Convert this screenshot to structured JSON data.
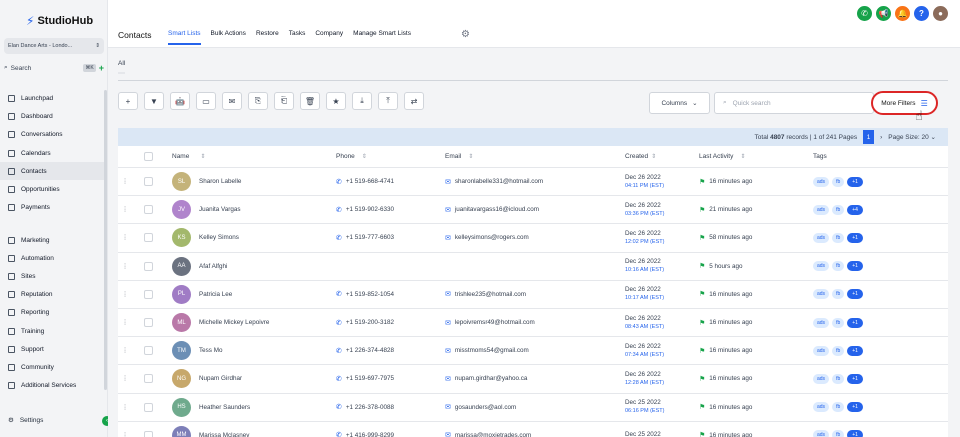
{
  "app": {
    "name": "StudioHub",
    "account": "Elan Dance Arts - Londo..."
  },
  "sidebar": {
    "search_label": "Search",
    "search_shortcut": "⌘K",
    "items": [
      {
        "label": "Launchpad",
        "icon": "rocket-icon"
      },
      {
        "label": "Dashboard",
        "icon": "dashboard-icon"
      },
      {
        "label": "Conversations",
        "icon": "chat-icon"
      },
      {
        "label": "Calendars",
        "icon": "calendar-icon"
      },
      {
        "label": "Contacts",
        "icon": "contacts-icon",
        "active": true
      },
      {
        "label": "Opportunities",
        "icon": "opportunities-icon"
      },
      {
        "label": "Payments",
        "icon": "payments-icon"
      }
    ],
    "items2": [
      {
        "label": "Marketing",
        "icon": "marketing-icon"
      },
      {
        "label": "Automation",
        "icon": "automation-icon"
      },
      {
        "label": "Sites",
        "icon": "sites-icon"
      },
      {
        "label": "Reputation",
        "icon": "reputation-icon"
      },
      {
        "label": "Reporting",
        "icon": "reporting-icon"
      },
      {
        "label": "Training",
        "icon": "training-icon"
      },
      {
        "label": "Support",
        "icon": "support-icon"
      },
      {
        "label": "Community",
        "icon": "community-icon"
      },
      {
        "label": "Additional Services",
        "icon": "services-icon"
      }
    ],
    "settings": "Settings"
  },
  "header": {
    "title": "Contacts",
    "tabs": [
      "Smart Lists",
      "Bulk Actions",
      "Restore",
      "Tasks",
      "Company",
      "Manage Smart Lists"
    ]
  },
  "content": {
    "all_tab": "All",
    "columns_label": "Columns",
    "search_placeholder": "Quick search",
    "more_filters_label": "More Filters",
    "total_text_prefix": "Total",
    "total_records": "4807",
    "total_text_suffix": "records | 1 of 241 Pages",
    "current_page": "1",
    "page_size_label": "Page Size: 20"
  },
  "table": {
    "headers": {
      "name": "Name",
      "phone": "Phone",
      "email": "Email",
      "created": "Created",
      "activity": "Last Activity",
      "tags": "Tags"
    },
    "rows": [
      {
        "initials": "SL",
        "color": "#c4b37a",
        "name": "Sharon Labelle",
        "phone": "+1 519-668-4741",
        "email": "sharonlabelle331@hotmail.com",
        "date": "Dec 26 2022",
        "time": "04:11 PM (EST)",
        "activity": "16 minutes ago",
        "more": "+1"
      },
      {
        "initials": "JV",
        "color": "#b084cc",
        "name": "Juanita Vargas",
        "phone": "+1 519-902-6330",
        "email": "juanitavargass16@icloud.com",
        "date": "Dec 26 2022",
        "time": "03:36 PM (EST)",
        "activity": "21 minutes ago",
        "more": "+4"
      },
      {
        "initials": "KS",
        "color": "#a3b86c",
        "name": "Kelley Simons",
        "phone": "+1 519-777-6603",
        "email": "kelleysimons@rogers.com",
        "date": "Dec 26 2022",
        "time": "12:02 PM (EST)",
        "activity": "58 minutes ago",
        "more": "+1"
      },
      {
        "initials": "AA",
        "color": "#6b7280",
        "name": "Afaf Alfghi",
        "phone": "",
        "email": "",
        "date": "Dec 26 2022",
        "time": "10:16 AM (EST)",
        "activity": "5 hours ago",
        "more": "+1"
      },
      {
        "initials": "PL",
        "color": "#a07cc5",
        "name": "Patricia Lee",
        "phone": "+1 519-852-1054",
        "email": "trishlee235@hotmail.com",
        "date": "Dec 26 2022",
        "time": "10:17 AM (EST)",
        "activity": "16 minutes ago",
        "more": "+1"
      },
      {
        "initials": "ML",
        "color": "#b978a8",
        "name": "Michelle Mickey Lepoivre",
        "phone": "+1 519-200-3182",
        "email": "lepoivremsr49@hotmail.com",
        "date": "Dec 26 2022",
        "time": "08:43 AM (EST)",
        "activity": "16 minutes ago",
        "more": "+1"
      },
      {
        "initials": "TM",
        "color": "#6c8fb5",
        "name": "Tess Mo",
        "phone": "+1 226-374-4828",
        "email": "misstmoms54@gmail.com",
        "date": "Dec 26 2022",
        "time": "07:34 AM (EST)",
        "activity": "16 minutes ago",
        "more": "+1"
      },
      {
        "initials": "NG",
        "color": "#c7a86b",
        "name": "Nupam Girdhar",
        "phone": "+1 519-697-7975",
        "email": "nupam.girdhar@yahoo.ca",
        "date": "Dec 26 2022",
        "time": "12:28 AM (EST)",
        "activity": "16 minutes ago",
        "more": "+1"
      },
      {
        "initials": "HS",
        "color": "#6faa8d",
        "name": "Heather Saunders",
        "phone": "+1 226-378-0088",
        "email": "gosaunders@aol.com",
        "date": "Dec 25 2022",
        "time": "06:16 PM (EST)",
        "activity": "16 minutes ago",
        "more": "+1"
      },
      {
        "initials": "MM",
        "color": "#7d7fb8",
        "name": "Marissa Mclasney",
        "phone": "+1 416-999-8299",
        "email": "marissa@moxietrades.com",
        "date": "Dec 25 2022",
        "time": "",
        "activity": "16 minutes ago",
        "more": "+1"
      }
    ],
    "tag_labels": [
      "ads",
      "fb"
    ]
  }
}
